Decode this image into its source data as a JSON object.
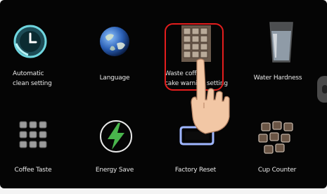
{
  "menu": {
    "items": [
      {
        "label_line1": "Automatic",
        "label_line2": "clean setting",
        "icon": "auto-clean-icon"
      },
      {
        "label": "Language",
        "icon": "globe-icon"
      },
      {
        "label_line1": "Waste coffee",
        "label_line2": "cake warning setting",
        "icon": "waste-coffee-icon"
      },
      {
        "label": "Water Hardness",
        "icon": "water-glass-icon"
      },
      {
        "label": "Coffee Taste",
        "icon": "coffee-taste-grid-icon"
      },
      {
        "label": "Energy Save",
        "icon": "energy-bolt-icon"
      },
      {
        "label": "Factory Reset",
        "icon": "factory-reset-icon"
      },
      {
        "label": "Cup Counter",
        "icon": "cup-counter-icon"
      }
    ]
  },
  "colors": {
    "background": "#050505",
    "highlight": "#e41d1d",
    "text": "#e8e8e8"
  }
}
